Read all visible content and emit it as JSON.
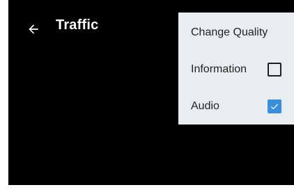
{
  "app_bar": {
    "back_icon": "arrow-left-icon",
    "title": "Traffic"
  },
  "overflow_menu": {
    "items": [
      {
        "label": "Change Quality",
        "has_checkbox": false
      },
      {
        "label": "Information",
        "has_checkbox": true,
        "checked": false
      },
      {
        "label": "Audio",
        "has_checkbox": true,
        "checked": true
      }
    ]
  },
  "colors": {
    "video_background": "#000000",
    "menu_background": "#e8eef0",
    "checkbox_checked": "#3a8fd8",
    "title_text": "#ffffff"
  }
}
